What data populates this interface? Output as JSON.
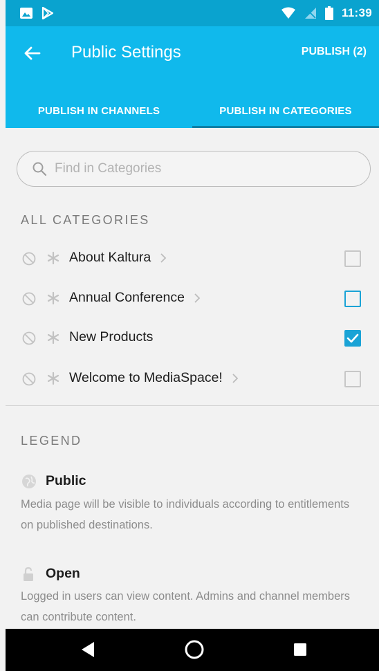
{
  "status_bar": {
    "time": "11:39"
  },
  "app_bar": {
    "title": "Public Settings",
    "publish_label": "PUBLISH (2)",
    "accent_color": "#10b9ec"
  },
  "tabs": [
    {
      "label": "PUBLISH IN CHANNELS",
      "selected": false
    },
    {
      "label": "PUBLISH IN CATEGORIES",
      "selected": true
    }
  ],
  "search": {
    "placeholder": "Find in Categories",
    "value": ""
  },
  "categories": {
    "heading": "ALL CATEGORIES",
    "items": [
      {
        "label": "About Kaltura",
        "has_children": true,
        "checked": false,
        "focused": false
      },
      {
        "label": "Annual Conference",
        "has_children": true,
        "checked": false,
        "focused": true
      },
      {
        "label": "New Products",
        "has_children": false,
        "checked": true,
        "focused": false
      },
      {
        "label": "Welcome to MediaSpace!",
        "has_children": true,
        "checked": false,
        "focused": false
      }
    ]
  },
  "legend": {
    "heading": "LEGEND",
    "items": [
      {
        "icon": "globe-icon",
        "title": "Public",
        "description": "Media page will be visible to individuals according to entitlements on published destinations."
      },
      {
        "icon": "lock-open-icon",
        "title": "Open",
        "description": "Logged in users can view content. Admins and channel members can contribute content."
      }
    ]
  }
}
